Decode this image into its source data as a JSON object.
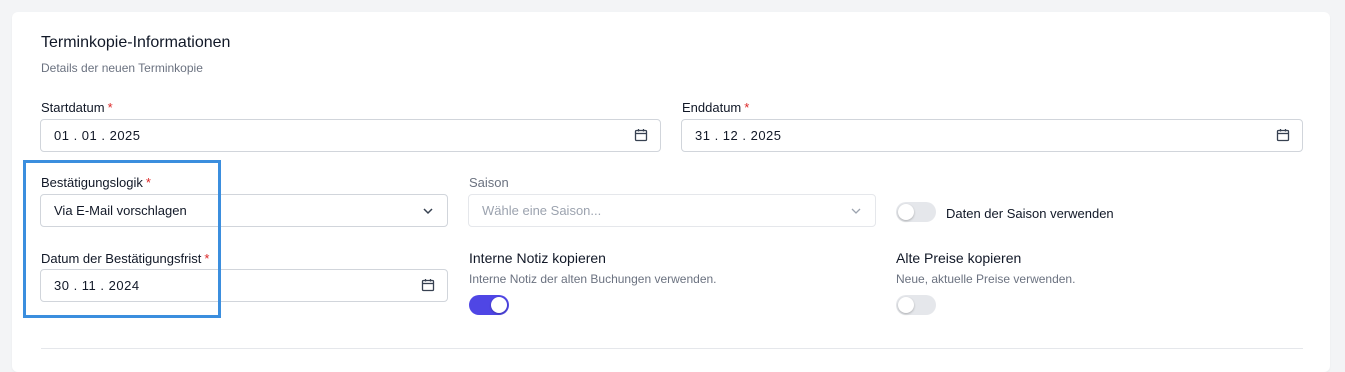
{
  "section": {
    "title": "Terminkopie-Informationen",
    "subtitle": "Details der neuen Terminkopie"
  },
  "required_marker": "*",
  "start_date": {
    "label": "Startdatum",
    "value": "01 . 01 . 2025",
    "icon": "calendar-icon"
  },
  "end_date": {
    "label": "Enddatum",
    "value": "31 . 12 . 2025",
    "icon": "calendar-icon"
  },
  "confirmation_logic": {
    "label": "Bestätigungslogik",
    "value": "Via E-Mail vorschlagen",
    "icon": "chevron-down-icon"
  },
  "season": {
    "label": "Saison",
    "placeholder": "Wähle eine Saison...",
    "icon": "chevron-down-icon"
  },
  "use_season_data": {
    "label": "Daten der Saison verwenden",
    "on": false
  },
  "confirmation_deadline": {
    "label": "Datum der Bestätigungsfrist",
    "value": "30 . 11 . 2024",
    "icon": "calendar-icon"
  },
  "copy_internal_note": {
    "title": "Interne Notiz kopieren",
    "description": "Interne Notiz der alten Buchungen verwenden.",
    "on": true
  },
  "copy_old_prices": {
    "title": "Alte Preise kopieren",
    "description": "Neue, aktuelle Preise verwenden.",
    "on": false
  },
  "colors": {
    "accent": "#4f46e5",
    "required": "#dc2626",
    "highlight": "#3b8ede"
  }
}
